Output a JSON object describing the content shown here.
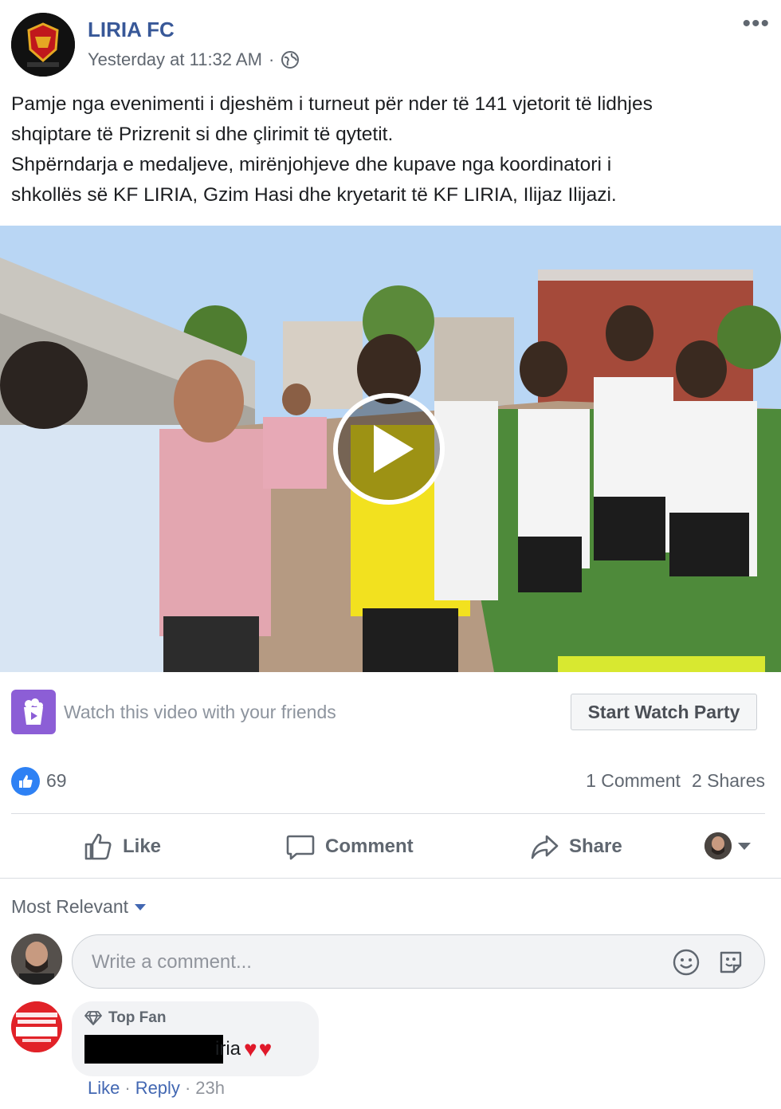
{
  "post": {
    "page_name": "LIRIA FC",
    "timestamp": "Yesterday at 11:32 AM",
    "separator": "·",
    "privacy_icon": "globe-icon",
    "more_icon": "more-dots-icon",
    "more_label": "•••",
    "text_lines": [
      "Pamje nga evenimenti i djeshëm i turneut për nder të 141 vjetorit të lidhjes",
      "shqiptare të Prizrenit si dhe çlirimit të qytetit.",
      "Shpërndarja e medaljeve, mirënjohjeve dhe kupave nga koordinatori i",
      "shkollës së KF LIRIA, Gzim Hasi dhe kryetarit të KF LIRIA, Ilijaz Ilijazi."
    ]
  },
  "video": {
    "play_icon": "play-icon"
  },
  "watch_party": {
    "prompt": "Watch this video with your friends",
    "button_label": "Start Watch Party",
    "icon": "watch-party-icon"
  },
  "reactions": {
    "like_count": "69",
    "comments": "1 Comment",
    "shares": "2 Shares"
  },
  "actions": {
    "like": "Like",
    "comment": "Comment",
    "share": "Share"
  },
  "comments_section": {
    "sort_label": "Most Relevant",
    "composer_placeholder": "Write a comment...",
    "comments": [
      {
        "badge": "Top Fan",
        "visible_text": "iria",
        "hearts": "♥♥",
        "like_label": "Like",
        "dot": "·",
        "reply_label": "Reply",
        "time": "23h"
      }
    ]
  },
  "colors": {
    "link_blue": "#385898",
    "accent_blue": "#4267b2",
    "like_blue": "#2e81f4",
    "watch_party_purple": "#8c5ed6",
    "muted_text": "#606770"
  }
}
